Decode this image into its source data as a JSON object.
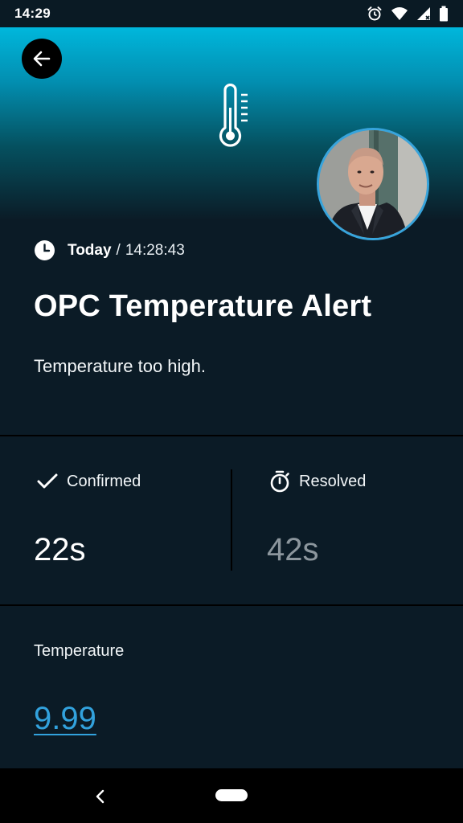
{
  "status_bar": {
    "time": "14:29",
    "icons": [
      "alarm-icon",
      "wifi-icon",
      "signal-icon",
      "battery-icon"
    ]
  },
  "header": {
    "back_icon": "arrow-back-icon",
    "alert_icon": "thermometer-icon",
    "accent_gradient": [
      "#00b7dc",
      "#0b1b26"
    ]
  },
  "alert": {
    "day": "Today",
    "separator": "/",
    "time": "14:28:43",
    "title": "OPC Temperature Alert",
    "description": "Temperature too high."
  },
  "stats": {
    "confirmed": {
      "label": "Confirmed",
      "value": "22s",
      "icon": "checkmark-icon"
    },
    "resolved": {
      "label": "Resolved",
      "value": "42s",
      "icon": "stopwatch-icon"
    }
  },
  "field": {
    "label": "Temperature",
    "value": "9.99",
    "link_color": "#32a2dd"
  },
  "colors": {
    "background": "#0b1b26",
    "avatar_ring": "#37a4dc",
    "muted_value": "#8c969d"
  }
}
